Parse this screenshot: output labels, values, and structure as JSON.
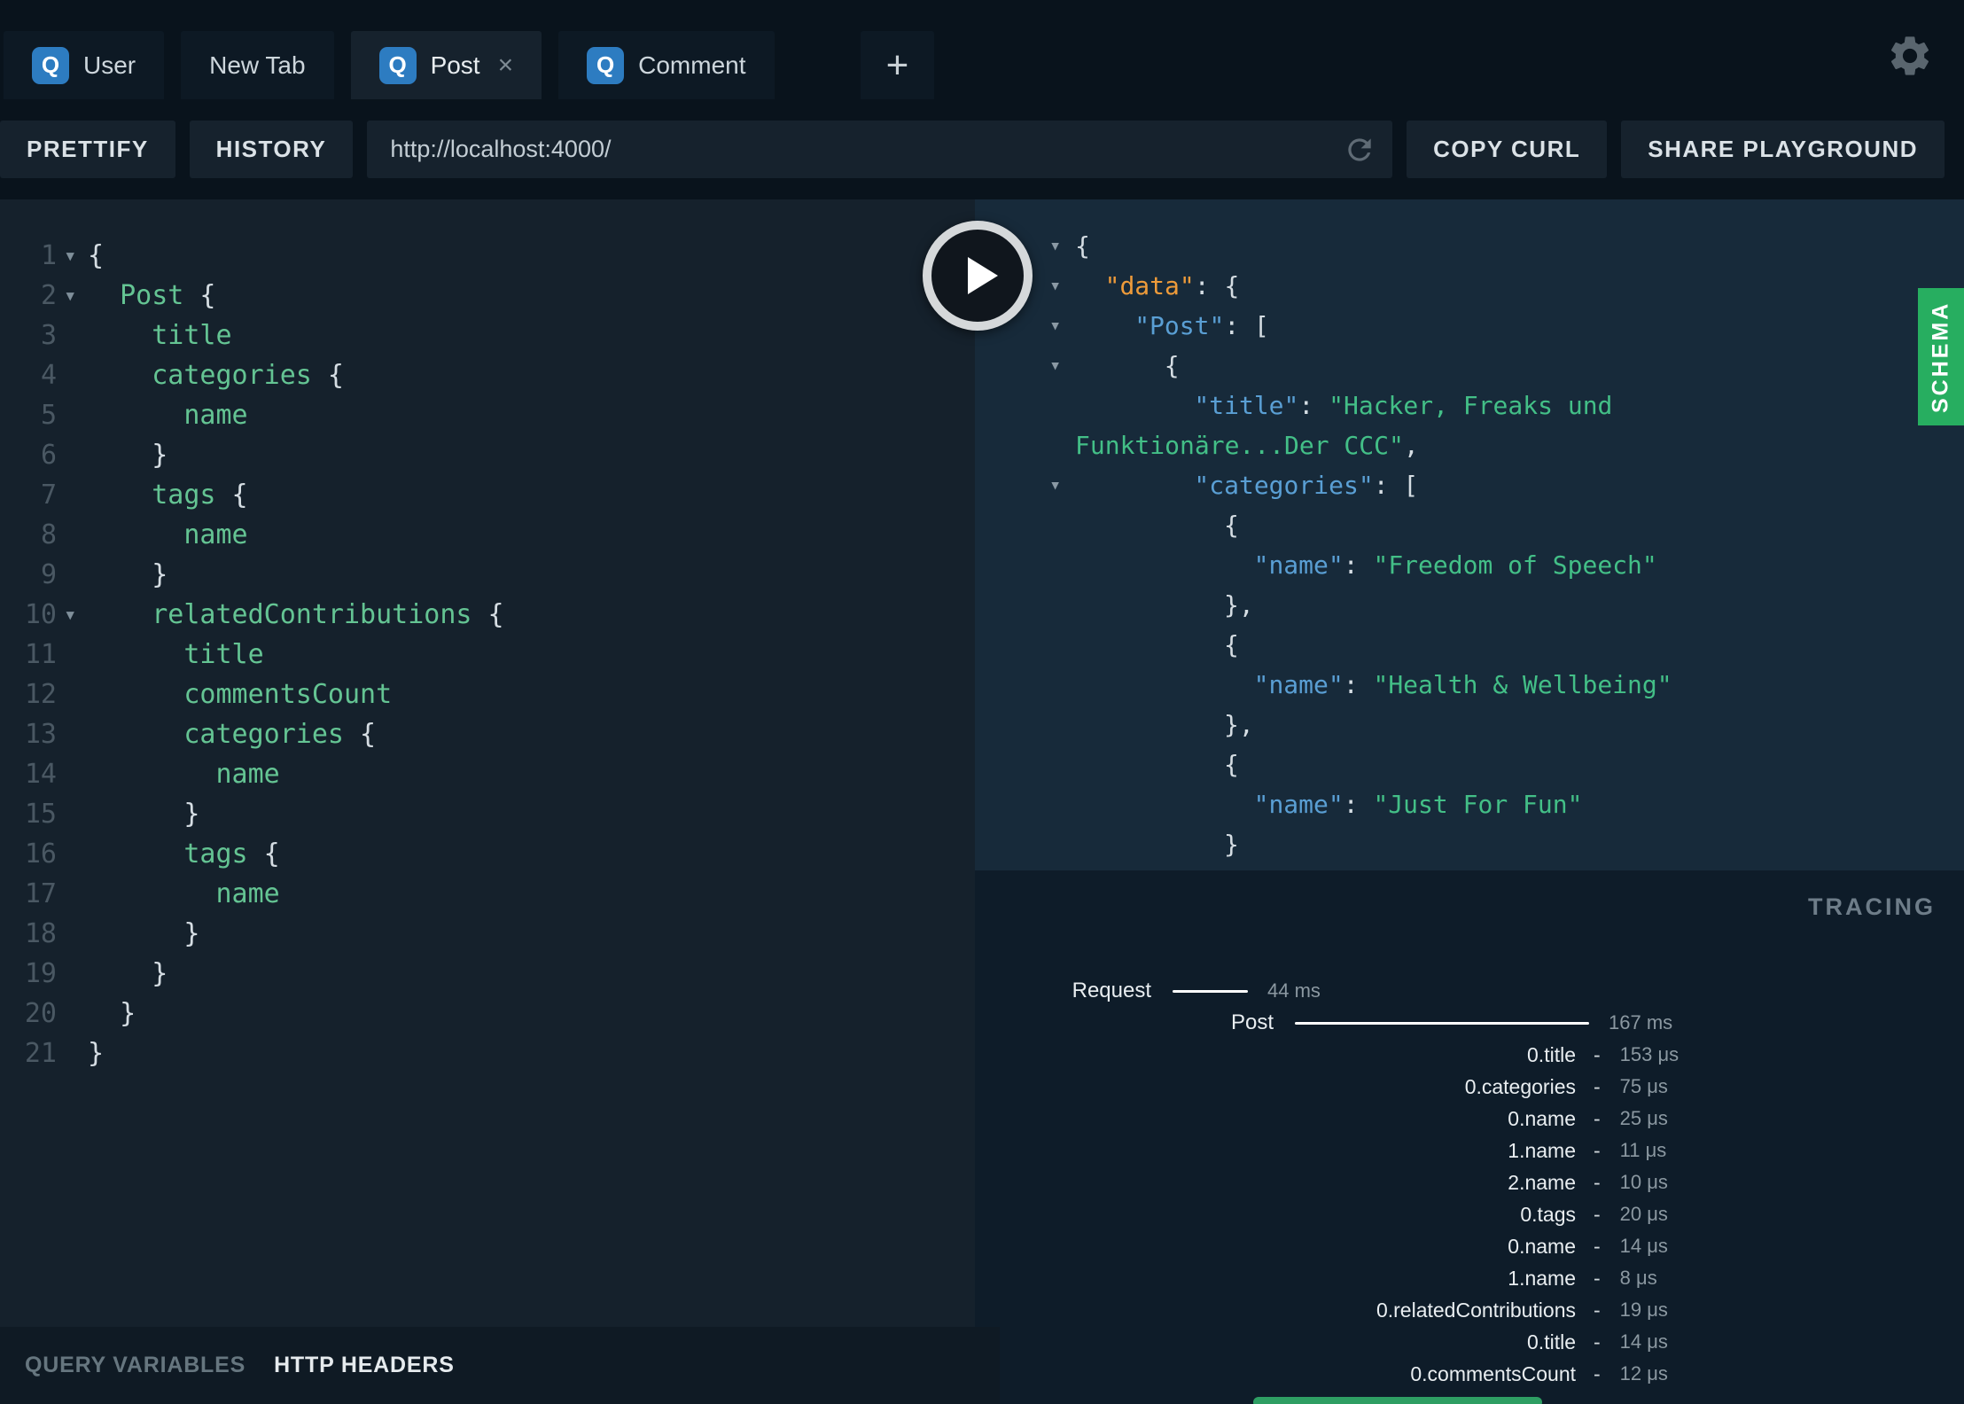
{
  "colors": {
    "schema_green": "#27ae60",
    "logo_blue": "#2d7cc1",
    "editor_field_green": "#64c493",
    "result_key_blue": "#5a9fd4",
    "result_data_orange": "#ee9b3a",
    "result_string_green": "#43bf87"
  },
  "tabs": {
    "logo_letter": "Q",
    "close_label": "×",
    "add_label": "+",
    "items": [
      {
        "label": "User",
        "logo": true,
        "active": false,
        "closable": false
      },
      {
        "label": "New Tab",
        "logo": false,
        "active": false,
        "closable": false
      },
      {
        "label": "Post",
        "logo": true,
        "active": true,
        "closable": true
      },
      {
        "label": "Comment",
        "logo": true,
        "active": false,
        "closable": false
      }
    ]
  },
  "toolbar": {
    "prettify": "PRETTIFY",
    "history": "HISTORY",
    "url": "http://localhost:4000/",
    "copy_curl": "COPY CURL",
    "share_playground": "SHARE PLAYGROUND"
  },
  "editor": {
    "fold_icon": "▾",
    "lines": [
      {
        "n": 1,
        "fold": true,
        "seg": [
          [
            "pn",
            "{"
          ]
        ]
      },
      {
        "n": 2,
        "fold": true,
        "seg": [
          [
            "pn",
            "  "
          ],
          [
            "fl",
            "Post"
          ],
          [
            "pn",
            " {"
          ]
        ]
      },
      {
        "n": 3,
        "seg": [
          [
            "pn",
            "    "
          ],
          [
            "fl",
            "title"
          ]
        ]
      },
      {
        "n": 4,
        "seg": [
          [
            "pn",
            "    "
          ],
          [
            "fl",
            "categories"
          ],
          [
            "pn",
            " {"
          ]
        ]
      },
      {
        "n": 5,
        "seg": [
          [
            "pn",
            "      "
          ],
          [
            "fl",
            "name"
          ]
        ]
      },
      {
        "n": 6,
        "seg": [
          [
            "pn",
            "    }"
          ]
        ]
      },
      {
        "n": 7,
        "seg": [
          [
            "pn",
            "    "
          ],
          [
            "fl",
            "tags"
          ],
          [
            "pn",
            " {"
          ]
        ]
      },
      {
        "n": 8,
        "seg": [
          [
            "pn",
            "      "
          ],
          [
            "fl",
            "name"
          ]
        ]
      },
      {
        "n": 9,
        "seg": [
          [
            "pn",
            "    }"
          ]
        ]
      },
      {
        "n": 10,
        "fold": true,
        "seg": [
          [
            "pn",
            "    "
          ],
          [
            "fl",
            "relatedContributions"
          ],
          [
            "pn",
            " {"
          ]
        ]
      },
      {
        "n": 11,
        "seg": [
          [
            "pn",
            "      "
          ],
          [
            "fl",
            "title"
          ]
        ]
      },
      {
        "n": 12,
        "seg": [
          [
            "pn",
            "      "
          ],
          [
            "fl",
            "commentsCount"
          ]
        ]
      },
      {
        "n": 13,
        "seg": [
          [
            "pn",
            "      "
          ],
          [
            "fl",
            "categories"
          ],
          [
            "pn",
            " {"
          ]
        ]
      },
      {
        "n": 14,
        "seg": [
          [
            "pn",
            "        "
          ],
          [
            "fl",
            "name"
          ]
        ]
      },
      {
        "n": 15,
        "seg": [
          [
            "pn",
            "      }"
          ]
        ]
      },
      {
        "n": 16,
        "seg": [
          [
            "pn",
            "      "
          ],
          [
            "fl",
            "tags"
          ],
          [
            "pn",
            " {"
          ]
        ]
      },
      {
        "n": 17,
        "seg": [
          [
            "pn",
            "        "
          ],
          [
            "fl",
            "name"
          ]
        ]
      },
      {
        "n": 18,
        "seg": [
          [
            "pn",
            "      }"
          ]
        ]
      },
      {
        "n": 19,
        "seg": [
          [
            "pn",
            "    }"
          ]
        ]
      },
      {
        "n": 20,
        "seg": [
          [
            "pn",
            "  }"
          ]
        ]
      },
      {
        "n": 21,
        "seg": [
          [
            "pn",
            "}"
          ]
        ]
      }
    ]
  },
  "results": {
    "collapse_icon": "▾",
    "lines": [
      {
        "arrow": true,
        "ind": 0,
        "seg": [
          [
            "pn",
            "{"
          ]
        ]
      },
      {
        "arrow": true,
        "ind": 2,
        "seg": [
          [
            "keyo",
            "\"data\""
          ],
          [
            "pn",
            ": {"
          ]
        ]
      },
      {
        "arrow": true,
        "ind": 4,
        "seg": [
          [
            "key",
            "\"Post\""
          ],
          [
            "pn",
            ": ["
          ]
        ]
      },
      {
        "arrow": true,
        "ind": 6,
        "seg": [
          [
            "pn",
            "{"
          ]
        ]
      },
      {
        "ind": 8,
        "seg": [
          [
            "key",
            "\"title\""
          ],
          [
            "pn",
            ": "
          ],
          [
            "str",
            "\"Hacker, Freaks und"
          ]
        ]
      },
      {
        "ind": 0,
        "seg": [
          [
            "str",
            "Funktionäre...Der CCC\""
          ],
          [
            "pn",
            ","
          ]
        ]
      },
      {
        "arrow": true,
        "ind": 8,
        "seg": [
          [
            "key",
            "\"categories\""
          ],
          [
            "pn",
            ": ["
          ]
        ]
      },
      {
        "ind": 10,
        "seg": [
          [
            "pn",
            "{"
          ]
        ]
      },
      {
        "ind": 12,
        "seg": [
          [
            "key",
            "\"name\""
          ],
          [
            "pn",
            ": "
          ],
          [
            "str",
            "\"Freedom of Speech\""
          ]
        ]
      },
      {
        "ind": 10,
        "seg": [
          [
            "pn",
            "},"
          ]
        ]
      },
      {
        "ind": 10,
        "seg": [
          [
            "pn",
            "{"
          ]
        ]
      },
      {
        "ind": 12,
        "seg": [
          [
            "key",
            "\"name\""
          ],
          [
            "pn",
            ": "
          ],
          [
            "str",
            "\"Health & Wellbeing\""
          ]
        ]
      },
      {
        "ind": 10,
        "seg": [
          [
            "pn",
            "},"
          ]
        ]
      },
      {
        "ind": 10,
        "seg": [
          [
            "pn",
            "{"
          ]
        ]
      },
      {
        "ind": 12,
        "seg": [
          [
            "key",
            "\"name\""
          ],
          [
            "pn",
            ": "
          ],
          [
            "str",
            "\"Just For Fun\""
          ]
        ]
      },
      {
        "ind": 10,
        "seg": [
          [
            "pn",
            "}"
          ]
        ]
      },
      {
        "ind": 8,
        "seg": [
          [
            "pn",
            "]"
          ]
        ]
      }
    ]
  },
  "schema": {
    "label": "SCHEMA"
  },
  "tracing": {
    "title": "TRACING",
    "separator": "-",
    "rows": [
      {
        "type": "request",
        "label": "Request",
        "time": "44 ms"
      },
      {
        "type": "post",
        "label": "Post",
        "time": "167 ms"
      },
      {
        "type": "field",
        "label": "0.title",
        "time": "153 μs"
      },
      {
        "type": "field",
        "label": "0.categories",
        "time": "75 μs"
      },
      {
        "type": "field",
        "label": "0.name",
        "time": "25 μs"
      },
      {
        "type": "field",
        "label": "1.name",
        "time": "11 μs"
      },
      {
        "type": "field",
        "label": "2.name",
        "time": "10 μs"
      },
      {
        "type": "field",
        "label": "0.tags",
        "time": "20 μs"
      },
      {
        "type": "field",
        "label": "0.name",
        "time": "14 μs"
      },
      {
        "type": "field",
        "label": "1.name",
        "time": "8 μs"
      },
      {
        "type": "field",
        "label": "0.relatedContributions",
        "time": "19 μs"
      },
      {
        "type": "field",
        "label": "0.title",
        "time": "14 μs"
      },
      {
        "type": "field",
        "label": "0.commentsCount",
        "time": "12 μs"
      }
    ]
  },
  "footer": {
    "query_variables": "QUERY VARIABLES",
    "http_headers": "HTTP HEADERS"
  }
}
